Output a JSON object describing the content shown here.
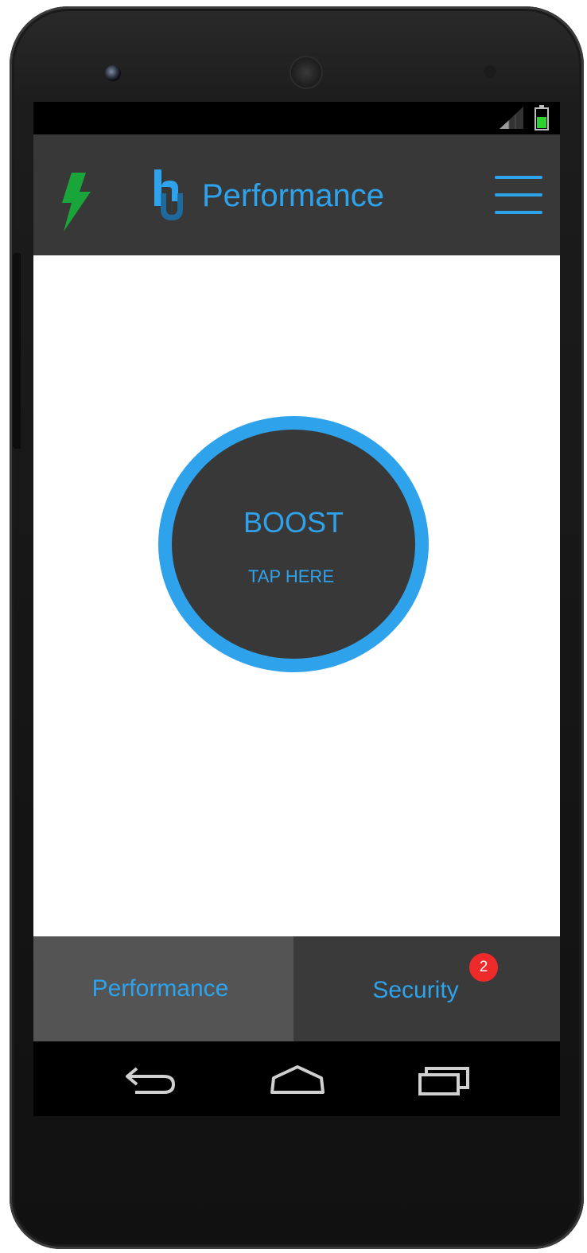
{
  "status_bar": {
    "signal_icon": "signal-strength-icon",
    "battery_icon": "battery-icon",
    "battery_color": "#2fd12f"
  },
  "header": {
    "title": "Performance",
    "left_icon": "lightning-bolt-icon",
    "logo_icon": "app-logo-icon",
    "menu_icon": "hamburger-menu-icon",
    "bolt_color": "#1aa53a",
    "accent_color": "#2ea3ec",
    "background_color": "#383838"
  },
  "boost": {
    "label": "BOOST",
    "sublabel": "TAP HERE",
    "ring_color": "#2ea3ec",
    "fill_color": "#383838"
  },
  "tabs": [
    {
      "label": "Performance",
      "selected": true
    },
    {
      "label": "Security",
      "selected": false,
      "badge": "2"
    }
  ],
  "badge_color": "#ee2a2a",
  "nav": {
    "back_icon": "back-icon",
    "home_icon": "home-icon",
    "recents_icon": "recent-apps-icon"
  }
}
